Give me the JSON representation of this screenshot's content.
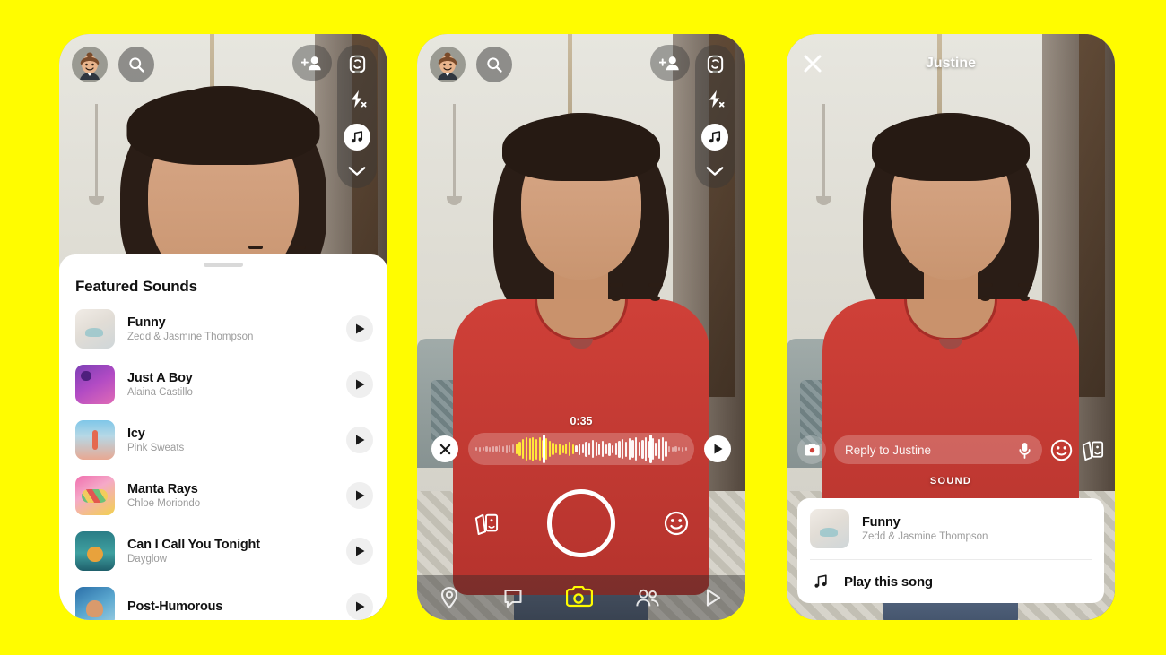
{
  "theme": {
    "background_color": "#FFFC00",
    "accent_color": "#FFFC00",
    "sheet_color": "#FFFFFF",
    "text_primary": "#111111",
    "text_secondary": "#9B9B9B"
  },
  "panel1": {
    "avatar": "bitmoji-avatar",
    "search_icon": "search-icon",
    "add_friend_icon": "add-friend-icon",
    "flip_camera_icon": "flip-camera-icon",
    "flash_off_icon": "flash-off-icon",
    "music_icon": "music-note-icon",
    "more_icon": "chevron-down-icon",
    "sheet": {
      "title": "Featured Sounds",
      "sounds": [
        {
          "title": "Funny",
          "artist": "Zedd & Jasmine Thompson",
          "art": "art-a"
        },
        {
          "title": "Just A Boy",
          "artist": "Alaina Castillo",
          "art": "art-b"
        },
        {
          "title": "Icy",
          "artist": "Pink Sweats",
          "art": "art-c"
        },
        {
          "title": "Manta Rays",
          "artist": "Chloe Moriondo",
          "art": "art-d"
        },
        {
          "title": "Can I Call You Tonight",
          "artist": "Dayglow",
          "art": "art-e"
        },
        {
          "title": "Post-Humorous",
          "artist": "",
          "art": "art-f"
        }
      ],
      "play_icon": "play-icon"
    }
  },
  "panel2": {
    "avatar": "bitmoji-avatar",
    "search_icon": "search-icon",
    "add_friend_icon": "add-friend-icon",
    "flip_camera_icon": "flip-camera-icon",
    "flash_off_icon": "flash-off-icon",
    "music_icon": "music-note-icon",
    "more_icon": "chevron-down-icon",
    "trimmer": {
      "duration": "0:35",
      "cancel_icon": "close-icon",
      "play_icon": "play-icon",
      "waveform_label": "sound-waveform"
    },
    "capture": {
      "sticker_icon": "sticker-icon",
      "shutter": "shutter-button",
      "emoji_icon": "emoji-icon"
    },
    "bottom_nav": [
      {
        "icon": "map-pin-icon",
        "name": "map",
        "active": false
      },
      {
        "icon": "chat-icon",
        "name": "chat",
        "active": false
      },
      {
        "icon": "camera-icon",
        "name": "camera",
        "active": true
      },
      {
        "icon": "friends-icon",
        "name": "friends",
        "active": false
      },
      {
        "icon": "spotlight-icon",
        "name": "spotlight",
        "active": false
      }
    ]
  },
  "panel3": {
    "close_icon": "close-icon",
    "title": "Justine",
    "reply": {
      "camera_icon": "camera-icon",
      "placeholder": "Reply to Justine",
      "mic_icon": "microphone-icon",
      "emoji_icon": "emoji-icon",
      "sticker_icon": "sticker-icon"
    },
    "sound_section_label": "SOUND",
    "sound_card": {
      "title": "Funny",
      "artist": "Zedd & Jasmine Thompson",
      "art": "art-a",
      "action_icon": "music-note-icon",
      "action_label": "Play this song"
    }
  }
}
